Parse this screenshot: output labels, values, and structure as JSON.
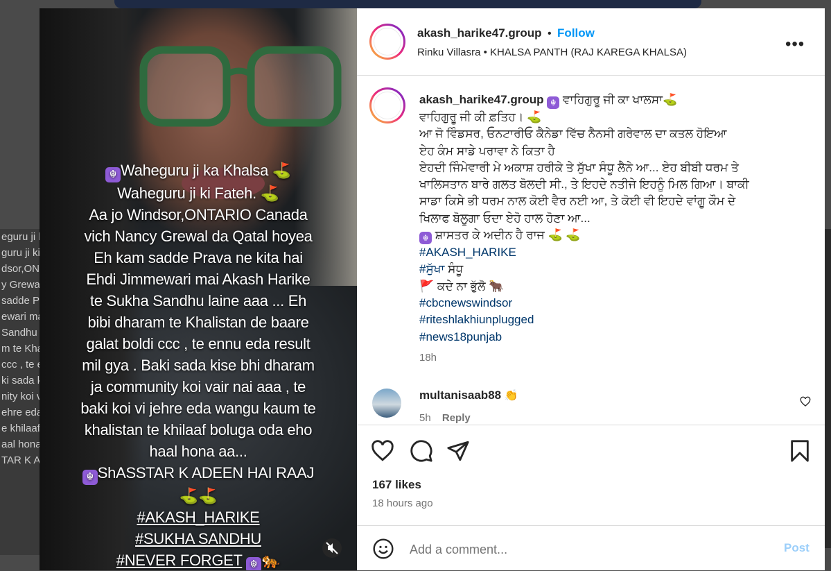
{
  "background": {
    "left_fragments": [
      "eguru ji k",
      "guru ji ki",
      "dsor,ONT",
      "y Grewal",
      "sadde Pra",
      "ewari ma",
      "Sandhu",
      "m te Kha",
      "ccc , te e",
      "ki sada k",
      "nity koi v",
      "ehre eda",
      "e khilaaf",
      "aal hona",
      "TAR K AD"
    ]
  },
  "media": {
    "overlay_lines": [
      "Waheguru ji ka Khalsa",
      "Waheguru ji ki Fateh.",
      "Aa jo Windsor,ONTARIO Canada",
      "vich Nancy Grewal da Qatal hoyea",
      "Eh kam sadde Prava ne kita hai",
      "Ehdi Jimmewari mai Akash Harike",
      "te Sukha Sandhu  laine aaa ... Eh",
      "bibi dharam te Khalistan de baare",
      "galat boldi ccc , te ennu eda result",
      "mil gya . Baki sada kise bhi dharam",
      "ja community koi vair nai aaa , te",
      "baki koi vi jehre eda wangu kaum te",
      "khalistan te khilaaf boluga oda eho",
      "haal hona aa...",
      "ShASSTAR K ADEEN HAI RAAJ"
    ],
    "hashtags": [
      "#AKASH_HARIKE",
      "#SUKHA SANDHU",
      "#NEVER FORGET"
    ]
  },
  "post": {
    "username": "akash_harike47.group",
    "dot": "•",
    "follow_label": "Follow",
    "audio_line": "Rinku Villasra • KHALSA PANTH (RAJ KAREGA KHALSA)",
    "more_label": "•••",
    "caption_first": "ਵਾਹਿਗੁਰੂ ਜੀ ਕਾ ਖਾਲਸਾ",
    "caption_lines": [
      "ਵਾਹਿਗੁਰੂ ਜੀ ਕੀ ਫ਼ਤਿਹ।",
      "ਆ ਜੋ ਵਿੰਡਸਰ, ਓਨਟਾਰੀਓ ਕੈਨੇਡਾ ਵਿੱਚ ਨੈਨਸੀ ਗਰੇਵਾਲ ਦਾ ਕਤਲ ਹੋਇਆ",
      "ਏਹ ਕੰਮ ਸਾਡੇ ਪਰਾਵਾ ਨੇ ਕਿਤਾ ਹੈ",
      "ਏਹਦੀ ਜਿੰਮੇਵਾਰੀ ਮੇ ਅਕਾਸ਼ ਹਰੀਕੇ ਤੇ ਸੁੱਖਾ ਸੰਧੂ ਲੈਨੇ ਆ... ਏਹ ਬੀਬੀ ਧਰਮ ਤੇ",
      "ਖਾਲਿਸਤਾਨ ਬਾਰੇ ਗਲਤ ਬੋਲਦੀ ਸੀ., ਤੇ ਇਹਦੇ ਨਤੀਜੇ ਇਹਨੂੰ ਮਿਲ ਗਿਆ। ਬਾਕੀ",
      "ਸਾਡਾ ਕਿਸੇ ਭੀ ਧਰਮ ਨਾਲ ਕੋਈ ਵੈਰ ਨਈ ਆ, ਤੇ ਕੋਈ ਵੀ ਇਹਦੇ ਵਾਂਗੂ ਕੌਮ ਦੇ",
      "ਖਿਲਾਫ ਬੋਲੂਗਾ ਓਦਾ ਏਹੋ ਹਾਲ ਹੋਣਾ ਆ...",
      "ਸ਼ਾਸਤਰ ਕੇ ਅਦੀਨ ਹੈ ਰਾਜ"
    ],
    "tag_akash": "#AKASH_HARIKE",
    "tag_sukha": "#ਸੁੱਖਾ",
    "sandhu": "ਸੰਧੂ",
    "never_forget": "ਕਦੇ ਨਾ ਭੁੱਲੋ",
    "tags_end": [
      "#cbcnewswindsor",
      "#riteshlakhiunplugged",
      "#news18punjab"
    ],
    "caption_time": "18h"
  },
  "comment": {
    "username": "multanisaab88",
    "time": "5h",
    "reply_label": "Reply"
  },
  "footer": {
    "likes": "167 likes",
    "posted": "18 hours ago",
    "comment_placeholder": "Add a comment...",
    "post_label": "Post"
  },
  "colors": {
    "accent": "#0095f6",
    "hashtag": "#00376b",
    "secondary_text": "#737373",
    "khanda_badge": "#8e5bd6"
  },
  "icons": [
    "khanda-icon",
    "golf-flag-icon",
    "tiger-icon",
    "red-flag-icon",
    "ox-icon",
    "clap-icon",
    "heart-icon",
    "comment-icon",
    "share-icon",
    "bookmark-icon",
    "emoji-icon",
    "mute-icon",
    "more-icon"
  ]
}
